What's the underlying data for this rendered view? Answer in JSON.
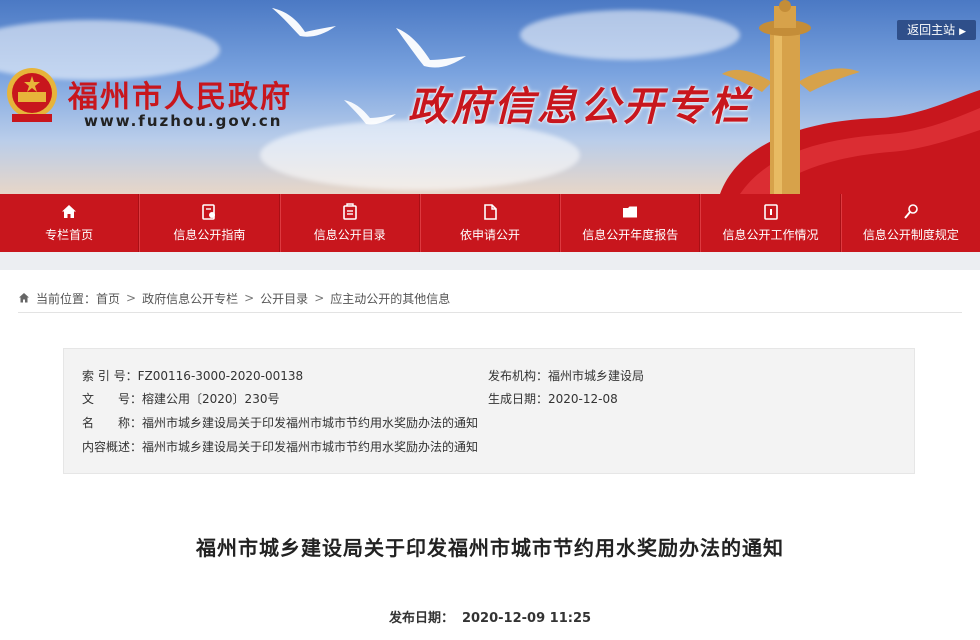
{
  "banner": {
    "site_title": "福州市人民政府",
    "site_url": "www.fuzhou.gov.cn",
    "column_title": "政府信息公开专栏",
    "return_label": "返回主站"
  },
  "nav": {
    "items": [
      {
        "label": "专栏首页",
        "icon": "home-icon"
      },
      {
        "label": "信息公开指南",
        "icon": "guide-icon"
      },
      {
        "label": "信息公开目录",
        "icon": "catalog-icon"
      },
      {
        "label": "依申请公开",
        "icon": "document-icon"
      },
      {
        "label": "信息公开年度报告",
        "icon": "folder-icon"
      },
      {
        "label": "信息公开工作情况",
        "icon": "clipboard-icon"
      },
      {
        "label": "信息公开制度规定",
        "icon": "search-person-icon"
      }
    ]
  },
  "breadcrumb": {
    "prefix": "当前位置：",
    "items": [
      "首页",
      "政府信息公开专栏",
      "公开目录",
      "应主动公开的其他信息"
    ]
  },
  "meta": {
    "index_label": "索 引 号：",
    "index_value": "FZ00116-3000-2020-00138",
    "publisher_label": "发布机构：",
    "publisher_value": "福州市城乡建设局",
    "doc_no_label": "文　　号：",
    "doc_no_value": "榕建公用〔2020〕230号",
    "created_label": "生成日期：",
    "created_value": "2020-12-08",
    "name_label": "名　　称：",
    "name_value": "福州市城乡建设局关于印发福州市城市节约用水奖励办法的通知",
    "summary_label": "内容概述：",
    "summary_value": "福州市城乡建设局关于印发福州市城市节约用水奖励办法的通知"
  },
  "article": {
    "title": "福州市城乡建设局关于印发福州市城市节约用水奖励办法的通知",
    "date_label": "发布日期：",
    "date_value": "2020-12-09 11:25"
  },
  "colors": {
    "brand_red": "#c8161d",
    "nav_red": "#c8161d",
    "meta_bg": "#f3f3f3"
  }
}
